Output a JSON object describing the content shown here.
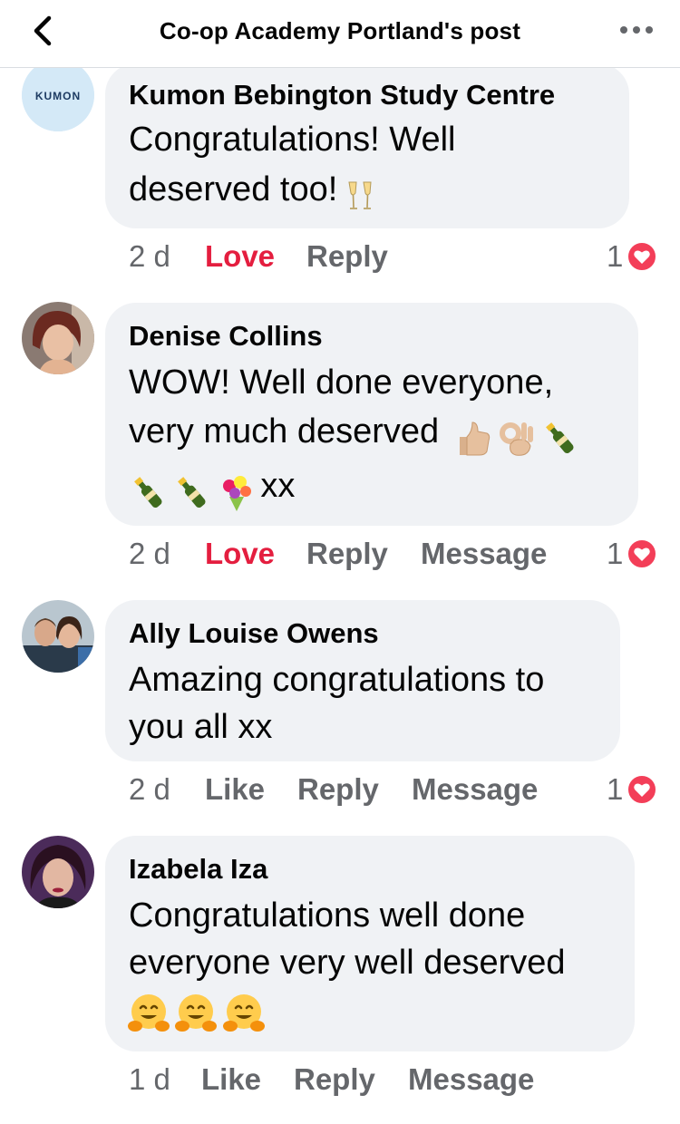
{
  "header": {
    "title": "Co-op Academy Portland's post"
  },
  "colors": {
    "love": "#e41e3f",
    "meta": "#65676b",
    "bubble": "#f0f2f5"
  },
  "comments": [
    {
      "author": "Kumon Bebington Study Centre",
      "avatar_label": "KUMON",
      "lines": [
        "Congratulations! Well",
        "deserved too!"
      ],
      "time": "2 d",
      "reacted_label": "Love",
      "reply_label": "Reply",
      "reaction_count": "1"
    },
    {
      "author": "Denise Collins",
      "lines": [
        "WOW! Well done everyone,",
        "very much deserved",
        "xx"
      ],
      "time": "2 d",
      "reacted_label": "Love",
      "reply_label": "Reply",
      "message_label": "Message",
      "reaction_count": "1"
    },
    {
      "author": "Ally Louise Owens",
      "lines": [
        "Amazing congratulations to",
        "you all xx"
      ],
      "time": "2 d",
      "like_label": "Like",
      "reply_label": "Reply",
      "message_label": "Message",
      "reaction_count": "1"
    },
    {
      "author": "Izabela Iza",
      "lines": [
        "Congratulations well done",
        "everyone very well deserved"
      ],
      "time": "1 d",
      "like_label": "Like",
      "reply_label": "Reply",
      "message_label": "Message"
    }
  ]
}
